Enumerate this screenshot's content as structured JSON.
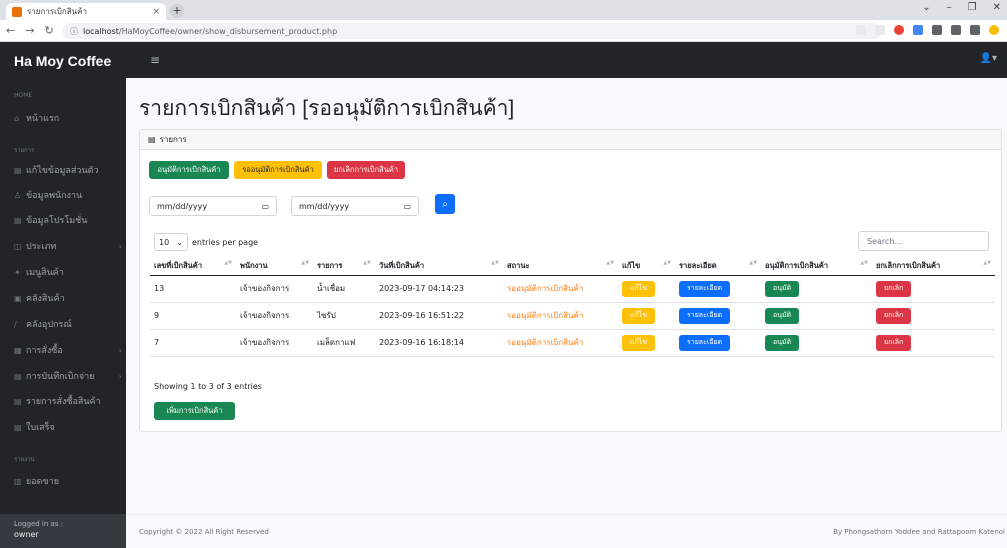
{
  "browser": {
    "tab_title": "รายการเบิกสินค้า",
    "tab_close": "×",
    "new_tab": "+",
    "url_host": "localhost",
    "url_path": "/HaMoyCoffee/owner/show_disbursement_product.php",
    "window_controls": [
      "⌄",
      "–",
      "❐",
      "✕"
    ]
  },
  "navbar": {
    "brand": "Ha Moy Coffee",
    "toggle_icon": "≡",
    "user_icon": "👤▾"
  },
  "sidebar": {
    "sections": [
      {
        "heading": "HOME",
        "items": [
          {
            "label": "หน้าแรก",
            "icon": "⌂",
            "submenu": false
          }
        ]
      },
      {
        "heading": "รายการ",
        "items": [
          {
            "label": "แก้ไขข้อมูลส่วนตัว",
            "icon": "▤",
            "submenu": false
          },
          {
            "label": "ข้อมูลพนักงาน",
            "icon": "♙",
            "submenu": false
          },
          {
            "label": "ข้อมูลโปรโมชั่น",
            "icon": "▤",
            "submenu": false
          },
          {
            "label": "ประเภท",
            "icon": "◫",
            "submenu": true
          },
          {
            "label": "เมนูสินค้า",
            "icon": "✦",
            "submenu": false
          },
          {
            "label": "คลังสินค้า",
            "icon": "▣",
            "submenu": false
          },
          {
            "label": "คลังอุปกรณ์",
            "icon": "∕",
            "submenu": false
          },
          {
            "label": "การสั่งซื้อ",
            "icon": "▦",
            "submenu": true
          },
          {
            "label": "การบันทึกเบิกจ่าย",
            "icon": "▤",
            "submenu": true
          },
          {
            "label": "รายการสั่งซื้อสินค้า",
            "icon": "▤",
            "submenu": false
          },
          {
            "label": "ใบเสร็จ",
            "icon": "▤",
            "submenu": false
          }
        ]
      },
      {
        "heading": "รายงาน",
        "items": [
          {
            "label": "ยอดขาย",
            "icon": "▥",
            "submenu": false
          }
        ]
      }
    ],
    "footer_label": "Logged in as :",
    "footer_user": "owner"
  },
  "page": {
    "title": "รายการเบิกสินค้า [รออนุมัติการเบิกสินค้า]"
  },
  "card": {
    "header_icon": "▤",
    "header_label": "รายการ",
    "filter_buttons": {
      "approved": "อนุมัติการเบิกสินค้า",
      "pending": "รออนุมัติการเบิกสินค้า",
      "cancelled": "ยกเลิกการเบิกสินค้า"
    },
    "date_from_placeholder": "mm/dd/yyyy",
    "date_to_placeholder": "mm/dd/yyyy",
    "calendar_icon": "▭",
    "search_icon": "⌕",
    "per_page_value": "10",
    "per_page_caret": "⌄",
    "per_page_label": "entries per page",
    "search_placeholder": "Search...",
    "sort_icon": "▲▼",
    "columns": [
      "เลขที่เบิกสินค้า",
      "พนักงาน",
      "รายการ",
      "วันที่เบิกสินค้า",
      "สถานะ",
      "แก้ไข",
      "รายละเอียด",
      "อนุมัติการเบิกสินค้า",
      "ยกเลิกการเบิกสินค้า"
    ],
    "rows": [
      {
        "id": "13",
        "employee": "เจ้าของกิจการ",
        "item": "น้ำเชื่อม",
        "date": "2023-09-17 04:14:23",
        "status": "รออนุมัติการเบิกสินค้า",
        "edit": "แก้ไข",
        "detail": "รายละเอียด",
        "approve": "อนุมัติ",
        "cancel": "ยกเลิก"
      },
      {
        "id": "9",
        "employee": "เจ้าของกิจการ",
        "item": "ไซรัป",
        "date": "2023-09-16 16:51:22",
        "status": "รออนุมัติการเบิกสินค้า",
        "edit": "แก้ไข",
        "detail": "รายละเอียด",
        "approve": "อนุมัติ",
        "cancel": "ยกเลิก"
      },
      {
        "id": "7",
        "employee": "เจ้าของกิจการ",
        "item": "เมล็ดกาแฟ",
        "date": "2023-09-16 16:18:14",
        "status": "รออนุมัติการเบิกสินค้า",
        "edit": "แก้ไข",
        "detail": "รายละเอียด",
        "approve": "อนุมัติ",
        "cancel": "ยกเลิก"
      }
    ],
    "info": "Showing 1 to 3 of 3 entries",
    "add_button": "เพิ่มการเบิกสินค้า"
  },
  "footer": {
    "copyright": "Copyright © 2022 All Right Reserved",
    "credit": "By Phongsathorn Yoddee and Rattapoom Katenoi"
  },
  "colors": {
    "success": "#198754",
    "warning": "#ffc107",
    "danger": "#dc3545",
    "primary": "#0d6efd",
    "status_pending": "#fd7e14",
    "sidebar_bg": "#212529"
  }
}
